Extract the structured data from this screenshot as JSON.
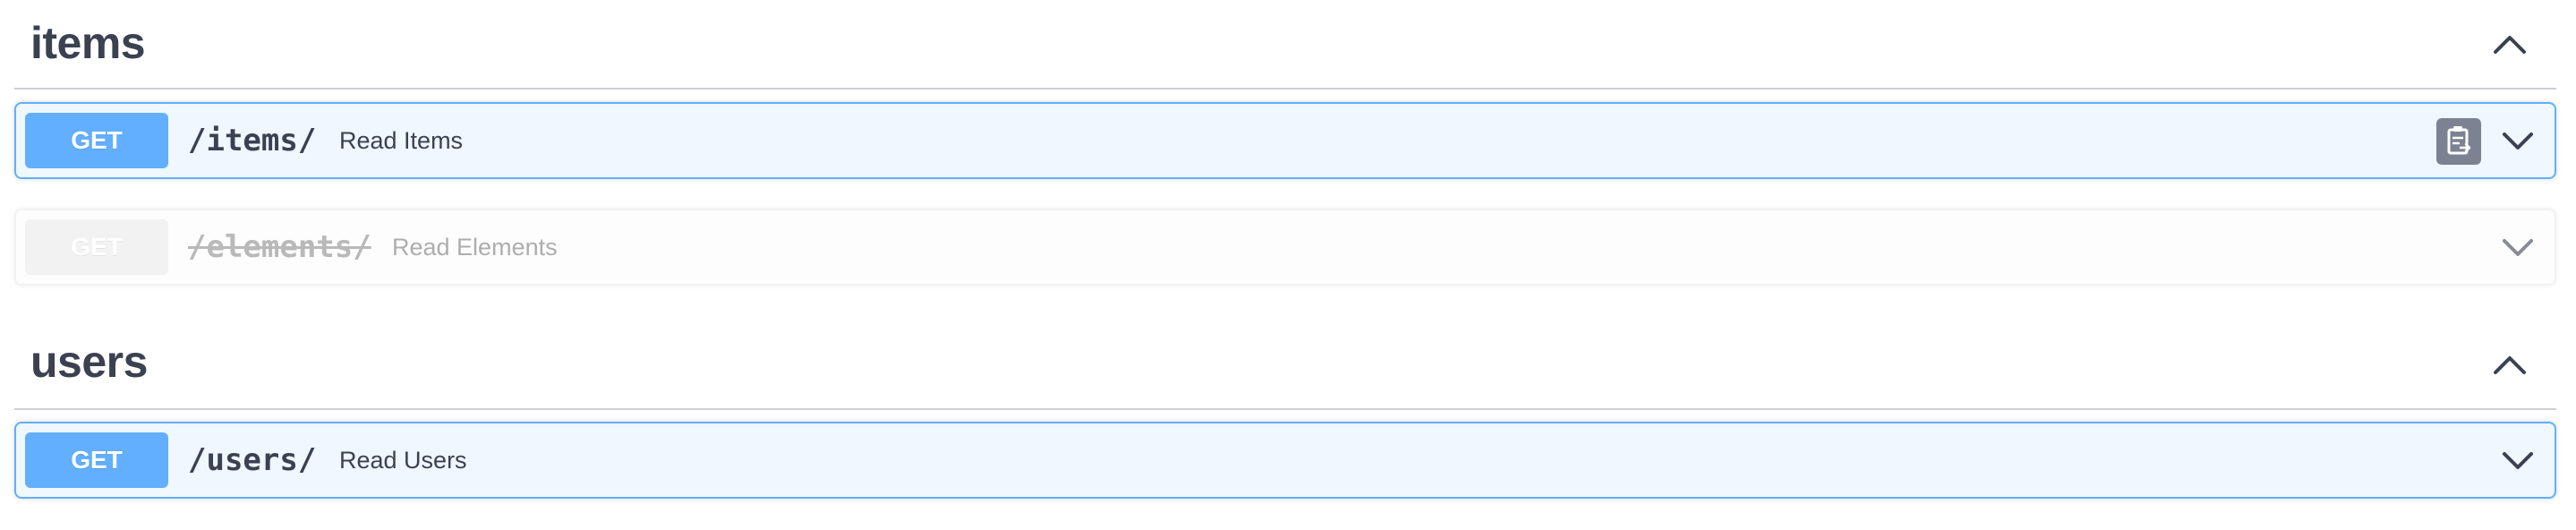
{
  "colors": {
    "get": "#61affe",
    "deprecated": "#ebebeb",
    "text": "#3b4151"
  },
  "sections": [
    {
      "title": "items",
      "operations": [
        {
          "method": "GET",
          "path": "/items/",
          "summary": "Read Items",
          "deprecated": false,
          "hovered": true
        },
        {
          "method": "GET",
          "path": "/elements/",
          "summary": "Read Elements",
          "deprecated": true,
          "hovered": false
        }
      ]
    },
    {
      "title": "users",
      "operations": [
        {
          "method": "GET",
          "path": "/users/",
          "summary": "Read Users",
          "deprecated": false,
          "hovered": false
        }
      ]
    }
  ],
  "icons": {
    "collapse": "chevron-up-icon",
    "expand": "chevron-down-icon",
    "copy": "clipboard-copy-icon"
  }
}
